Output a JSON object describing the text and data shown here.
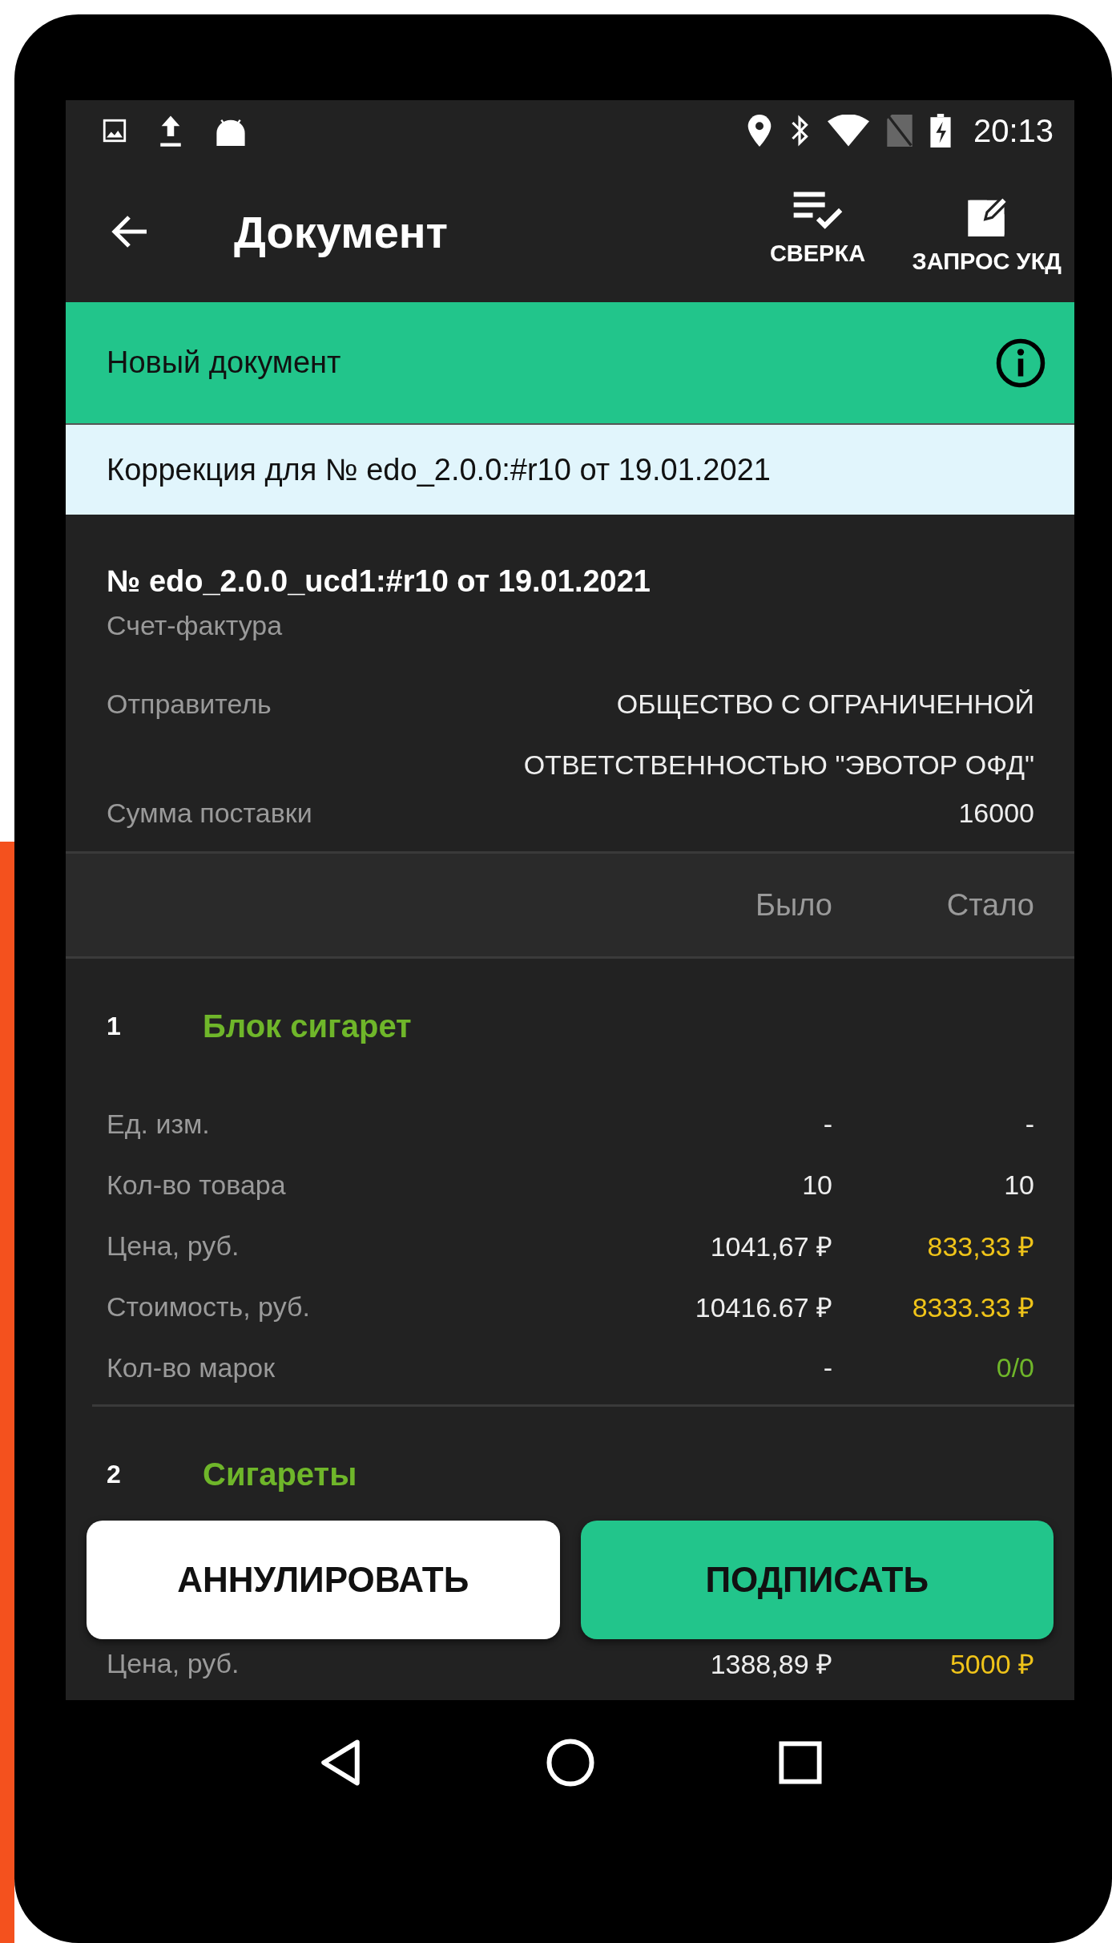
{
  "status_bar": {
    "time": "20:13"
  },
  "toolbar": {
    "title": "Документ",
    "actions": [
      {
        "label": "СВЕРКА",
        "kind": "checklist"
      },
      {
        "label": "ЗАПРОС УКД",
        "kind": "edit"
      }
    ]
  },
  "status_banner": {
    "text": "Новый документ"
  },
  "correction_note": {
    "text": "Коррекция для № edo_2.0.0:#r10 от 19.01.2021"
  },
  "document": {
    "number": "№ edo_2.0.0_ucd1:#r10 от 19.01.2021",
    "type": "Счет-фактура",
    "fields": [
      {
        "label": "Отправитель",
        "value": "ОБЩЕСТВО С ОГРАНИЧЕННОЙ ОТВЕТСТВЕННОСТЬЮ \"ЭВОТОР ОФД\""
      },
      {
        "label": "Сумма поставки",
        "value": "16000"
      }
    ]
  },
  "comparison": {
    "columns": [
      "Было",
      "Стало"
    ]
  },
  "items": [
    {
      "number": "1",
      "name": "Блок сигарет",
      "rows": [
        {
          "label": "Ед. изм.",
          "was": "-",
          "became": "-",
          "color": "#eeeeee"
        },
        {
          "label": "Кол-во товара",
          "was": "10",
          "became": "10",
          "color": "#eeeeee"
        },
        {
          "label": "Цена, руб.",
          "was": "1041,67 ₽",
          "became": "833,33 ₽",
          "color": "#f0c419"
        },
        {
          "label": "Стоимость, руб.",
          "was": "10416.67 ₽",
          "became": "8333.33 ₽",
          "color": "#f0c419"
        },
        {
          "label": "Кол-во марок",
          "was": "-",
          "became": "0/0",
          "color": "#6fb62a"
        }
      ]
    },
    {
      "number": "2",
      "name": "Сигареты",
      "rows": [
        {
          "label": "Цена, руб.",
          "was": "1388,89 ₽",
          "became": "5000 ₽",
          "color": "#f0c419"
        }
      ]
    }
  ],
  "buttons": [
    {
      "label": "АННУЛИРОВАТЬ",
      "kind": "secondary"
    },
    {
      "label": "ПОДПИСАТЬ",
      "kind": "primary"
    }
  ]
}
